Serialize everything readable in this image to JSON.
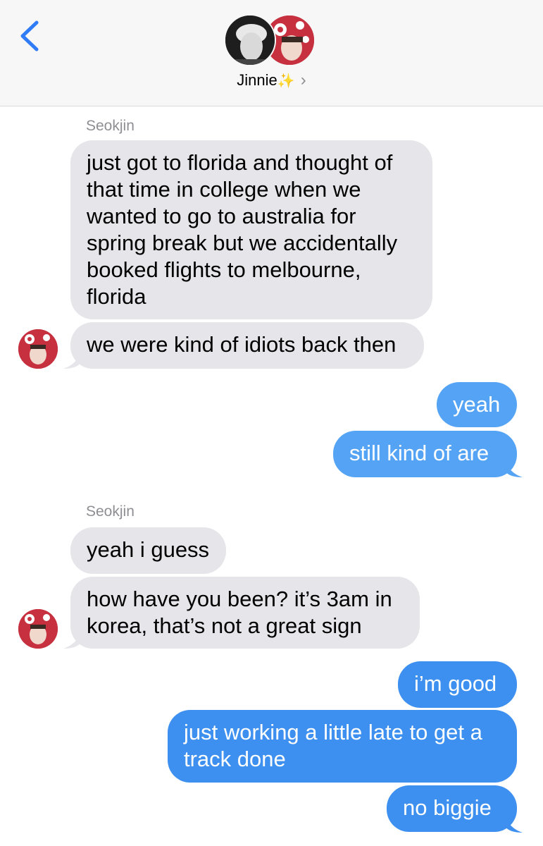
{
  "header": {
    "contact_name": "Jinnie",
    "contact_emoji": "✨",
    "chevron": "›",
    "back_icon": "chevron-left-icon",
    "accent_color": "#2f7cf6"
  },
  "messages": {
    "sender_1": "Seokjin",
    "m1": "just got to florida and thought of that time in college when we wanted to go to australia for spring break but we accidentally booked flights to melbourne, florida",
    "m2": "we were kind of idiots back then",
    "m3": "yeah",
    "m4": "still kind of are",
    "sender_2": "Seokjin",
    "m5": "yeah i guess",
    "m6": "how have you been? it’s 3am in korea, that’s not a great sign",
    "m7": "i’m good",
    "m8": "just working a little late to get a track done",
    "m9": "no biggie"
  },
  "colors": {
    "incoming_bubble": "#e5e5ea",
    "outgoing_bubble": "#3d8ff0",
    "outgoing_bubble_light": "#55a3f4"
  }
}
